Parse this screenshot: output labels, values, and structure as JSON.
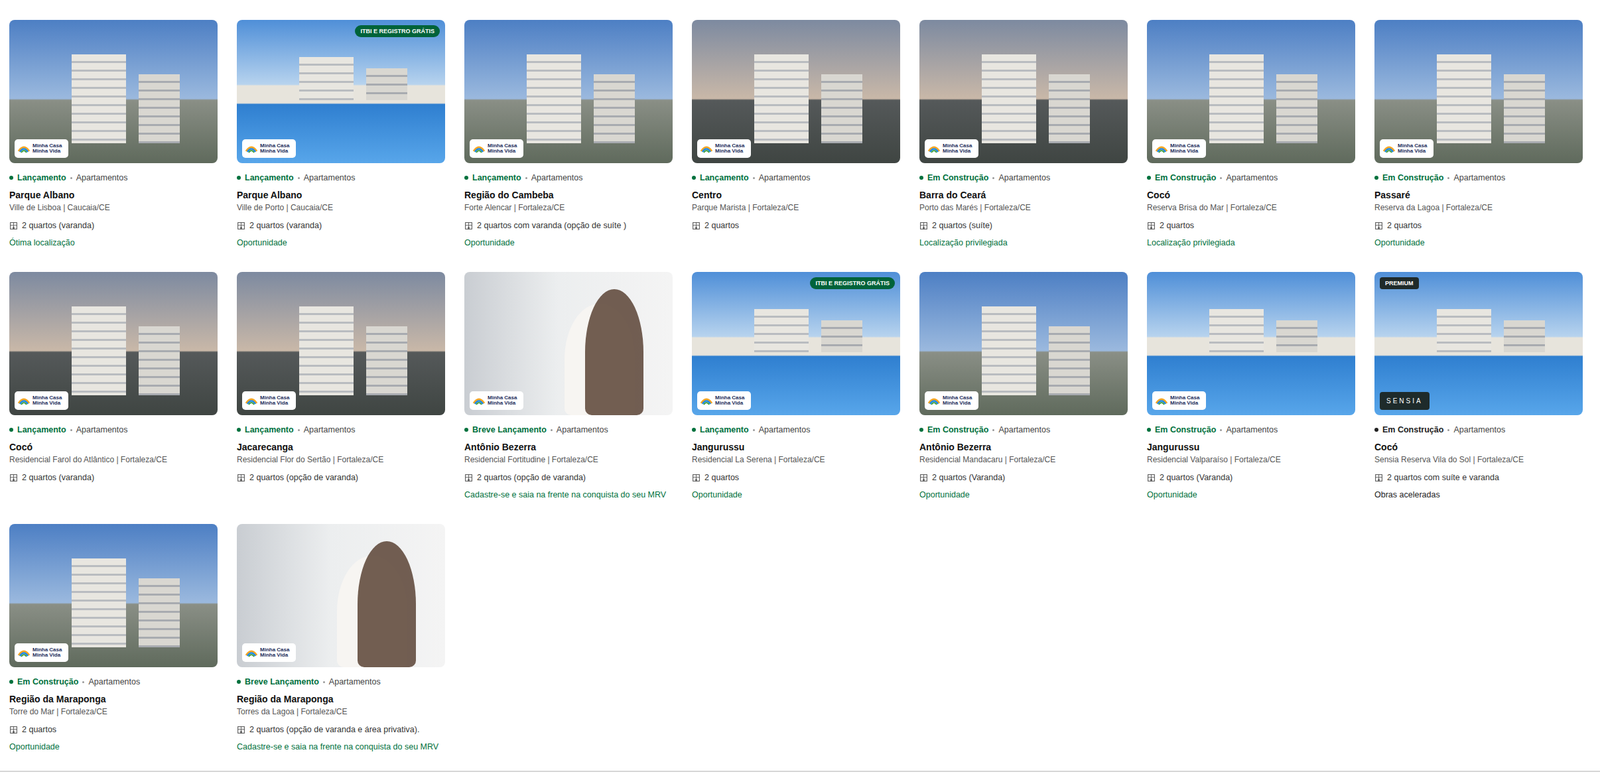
{
  "cards": [
    {
      "status": "Lançamento",
      "color": "#00713d",
      "type": "Apartamentos",
      "title": "Parque Albano",
      "subtitle": "Ville de Lisboa | Caucaia/CE",
      "rooms": "2 quartos (varanda)",
      "highlight": "Ótima localização",
      "highlight_color": "#00713d",
      "badge": "Minha Casa Minha Vida",
      "badge_kind": "mcmv",
      "tag": "",
      "tag_kind": "",
      "kind": "building"
    },
    {
      "status": "Lançamento",
      "color": "#00713d",
      "type": "Apartamentos",
      "title": "Parque Albano",
      "subtitle": "Ville de Porto | Caucaia/CE",
      "rooms": "2 quartos (varanda)",
      "highlight": "Oportunidade",
      "highlight_color": "#00713d",
      "badge": "Minha Casa Minha Vida",
      "badge_kind": "mcmv",
      "tag": "ITBI E REGISTRO GRÁTIS",
      "tag_kind": "itbi",
      "kind": "pool"
    },
    {
      "status": "Lançamento",
      "color": "#00713d",
      "type": "Apartamentos",
      "title": "Região do Cambeba",
      "subtitle": "Forte Alencar | Fortaleza/CE",
      "rooms": "2 quartos com varanda (opção de suíte )",
      "highlight": "Oportunidade",
      "highlight_color": "#00713d",
      "badge": "Minha Casa Minha Vida",
      "badge_kind": "mcmv",
      "tag": "",
      "tag_kind": "",
      "kind": "building"
    },
    {
      "status": "Lançamento",
      "color": "#00713d",
      "type": "Apartamentos",
      "title": "Centro",
      "subtitle": "Parque Marista | Fortaleza/CE",
      "rooms": "2 quartos",
      "highlight": "",
      "highlight_color": "#00713d",
      "badge": "Minha Casa Minha Vida",
      "badge_kind": "mcmv",
      "tag": "",
      "tag_kind": "",
      "kind": "dusk"
    },
    {
      "status": "Em Construção",
      "color": "#00713d",
      "type": "Apartamentos",
      "title": "Barra do Ceará",
      "subtitle": "Porto das Marés | Fortaleza/CE",
      "rooms": "2 quartos (suíte)",
      "highlight": "Localização privilegiada",
      "highlight_color": "#00713d",
      "badge": "Minha Casa Minha Vida",
      "badge_kind": "mcmv",
      "tag": "",
      "tag_kind": "",
      "kind": "dusk"
    },
    {
      "status": "Em Construção",
      "color": "#00713d",
      "type": "Apartamentos",
      "title": "Cocó",
      "subtitle": "Reserva Brisa do Mar | Fortaleza/CE",
      "rooms": "2 quartos",
      "highlight": "Localização privilegiada",
      "highlight_color": "#00713d",
      "badge": "Minha Casa Minha Vida",
      "badge_kind": "mcmv",
      "tag": "",
      "tag_kind": "",
      "kind": "building"
    },
    {
      "status": "Em Construção",
      "color": "#00713d",
      "type": "Apartamentos",
      "title": "Passaré",
      "subtitle": "Reserva da Lagoa | Fortaleza/CE",
      "rooms": "2 quartos",
      "highlight": "Oportunidade",
      "highlight_color": "#00713d",
      "badge": "Minha Casa Minha Vida",
      "badge_kind": "mcmv",
      "tag": "",
      "tag_kind": "",
      "kind": "building"
    },
    {
      "status": "Lançamento",
      "color": "#00713d",
      "type": "Apartamentos",
      "title": "Cocó",
      "subtitle": "Residencial Farol do Atlântico | Fortaleza/CE",
      "rooms": "2 quartos (varanda)",
      "highlight": "",
      "highlight_color": "#00713d",
      "badge": "Minha Casa Minha Vida",
      "badge_kind": "mcmv",
      "tag": "",
      "tag_kind": "",
      "kind": "dusk"
    },
    {
      "status": "Lançamento",
      "color": "#00713d",
      "type": "Apartamentos",
      "title": "Jacarecanga",
      "subtitle": "Residencial Flor do Sertão | Fortaleza/CE",
      "rooms": "2 quartos (opção de varanda)",
      "highlight": "",
      "highlight_color": "#00713d",
      "badge": "Minha Casa Minha Vida",
      "badge_kind": "mcmv",
      "tag": "",
      "tag_kind": "",
      "kind": "dusk"
    },
    {
      "status": "Breve Lançamento",
      "color": "#00713d",
      "type": "Apartamentos",
      "title": "Antônio Bezerra",
      "subtitle": "Residencial Fortitudine | Fortaleza/CE",
      "rooms": "2 quartos (opção de varanda)",
      "highlight": "Cadastre-se e saia na frente na conquista do seu MRV",
      "highlight_color": "#00713d",
      "badge": "Minha Casa Minha Vida",
      "badge_kind": "mcmv",
      "tag": "",
      "tag_kind": "",
      "kind": "people"
    },
    {
      "status": "Lançamento",
      "color": "#00713d",
      "type": "Apartamentos",
      "title": "Jangurussu",
      "subtitle": "Residencial La Serena | Fortaleza/CE",
      "rooms": "2 quartos",
      "highlight": "Oportunidade",
      "highlight_color": "#00713d",
      "badge": "Minha Casa Minha Vida",
      "badge_kind": "mcmv",
      "tag": "ITBI E REGISTRO GRÁTIS",
      "tag_kind": "itbi",
      "kind": "pool"
    },
    {
      "status": "Em Construção",
      "color": "#00713d",
      "type": "Apartamentos",
      "title": "Antônio Bezerra",
      "subtitle": "Residencial Mandacaru | Fortaleza/CE",
      "rooms": "2 quartos (Varanda)",
      "highlight": "Oportunidade",
      "highlight_color": "#00713d",
      "badge": "Minha Casa Minha Vida",
      "badge_kind": "mcmv",
      "tag": "",
      "tag_kind": "",
      "kind": "building"
    },
    {
      "status": "Em Construção",
      "color": "#00713d",
      "type": "Apartamentos",
      "title": "Jangurussu",
      "subtitle": "Residencial Valparaíso | Fortaleza/CE",
      "rooms": "2 quartos (Varanda)",
      "highlight": "Oportunidade",
      "highlight_color": "#00713d",
      "badge": "Minha Casa Minha Vida",
      "badge_kind": "mcmv",
      "tag": "",
      "tag_kind": "",
      "kind": "pool"
    },
    {
      "status": "Em Construção",
      "color": "#222222",
      "type": "Apartamentos",
      "title": "Cocó",
      "subtitle": "Sensia Reserva Vila do Sol | Fortaleza/CE",
      "rooms": "2 quartos com suíte e varanda",
      "highlight": "Obras aceleradas",
      "highlight_color": "#222222",
      "badge": "SENSIA",
      "badge_kind": "sensia",
      "tag": "PREMIUM",
      "tag_kind": "premium",
      "kind": "pool"
    },
    {
      "status": "Em Construção",
      "color": "#00713d",
      "type": "Apartamentos",
      "title": "Região da Maraponga",
      "subtitle": "Torre do Mar | Fortaleza/CE",
      "rooms": "2 quartos",
      "highlight": "Oportunidade",
      "highlight_color": "#00713d",
      "badge": "Minha Casa Minha Vida",
      "badge_kind": "mcmv",
      "tag": "",
      "tag_kind": "",
      "kind": "building"
    },
    {
      "status": "Breve Lançamento",
      "color": "#00713d",
      "type": "Apartamentos",
      "title": "Região da Maraponga",
      "subtitle": "Torres da Lagoa | Fortaleza/CE",
      "rooms": "2 quartos (opção de varanda e área privativa).",
      "highlight": "Cadastre-se e saia na frente na conquista do seu MRV",
      "highlight_color": "#00713d",
      "badge": "Minha Casa Minha Vida",
      "badge_kind": "mcmv",
      "tag": "",
      "tag_kind": "",
      "kind": "people"
    }
  ]
}
